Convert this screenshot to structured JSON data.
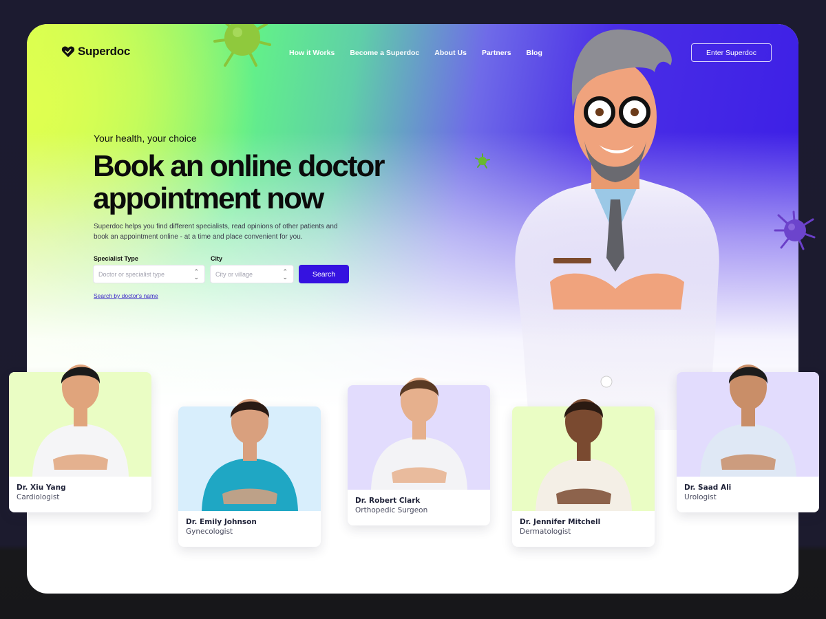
{
  "brand": {
    "name": "Superdoc",
    "logo_icon": "heart-check-icon",
    "accent": "#3512e0"
  },
  "nav": {
    "items": [
      {
        "label": "How it Works"
      },
      {
        "label": "Become a Superdoc"
      },
      {
        "label": "About Us"
      },
      {
        "label": "Partners"
      },
      {
        "label": "Blog"
      }
    ],
    "cta_label": "Enter Superdoc"
  },
  "hero": {
    "eyebrow": "Your health, your choice",
    "headline_line1": "Book an online doctor",
    "headline_line2": "appointment now",
    "description": "Superdoc helps you find different specialists, read opinions of other patients and book an appointment online - at a time and place convenient for you."
  },
  "search": {
    "specialist_label": "Specialist Type",
    "specialist_placeholder": "Doctor or specialist type",
    "city_label": "City",
    "city_placeholder": "City or village",
    "button_label": "Search",
    "name_link": "Search by doctor's name"
  },
  "doctors": [
    {
      "name": "Dr. Xiu Yang",
      "specialty": "Cardiologist",
      "bg": "#eafdc4"
    },
    {
      "name": "Dr. Emily Johnson",
      "specialty": "Gynecologist",
      "bg": "#d8eefc"
    },
    {
      "name": "Dr. Robert Clark",
      "specialty": "Orthopedic Surgeon",
      "bg": "#e2dcfd"
    },
    {
      "name": "Dr. Jennifer Mitchell",
      "specialty": "Dermatologist",
      "bg": "#eafdc4"
    },
    {
      "name": "Dr. Saad Ali",
      "specialty": "Urologist",
      "bg": "#e2dcfd"
    }
  ]
}
